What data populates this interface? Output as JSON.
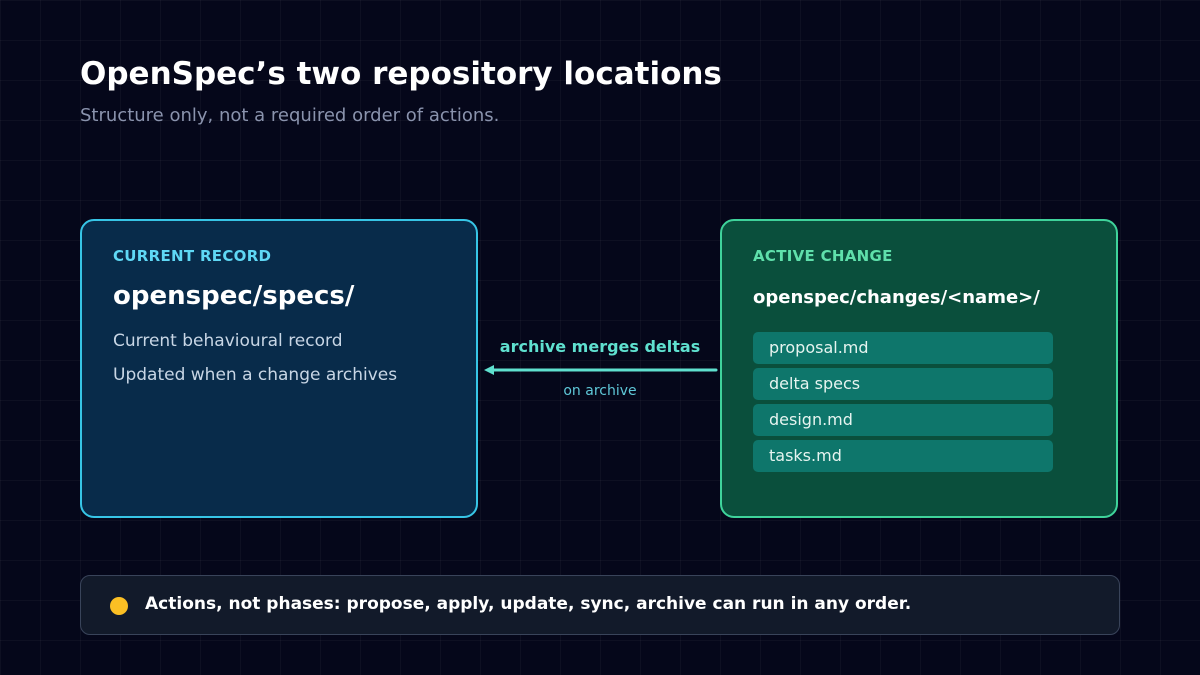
{
  "header": {
    "title": "OpenSpec’s two repository locations",
    "subtitle": "Structure only, not a required order of actions."
  },
  "current_record": {
    "label": "CURRENT RECORD",
    "path": "openspec/specs/",
    "lines": [
      "Current behavioural record",
      "Updated when a change archives"
    ],
    "accent": "#37c5e6"
  },
  "active_change": {
    "label": "ACTIVE CHANGE",
    "path": "openspec/changes/<name>/",
    "files": [
      "proposal.md",
      "delta specs",
      "design.md",
      "tasks.md"
    ],
    "accent": "#3fd39b"
  },
  "flow": {
    "label": "archive merges deltas",
    "caption": "on archive",
    "color": "#5fe0cf"
  },
  "note": {
    "text": "Actions, not phases: propose, apply, update, sync, archive can run in any order.",
    "dot_color": "#fbbf24"
  }
}
